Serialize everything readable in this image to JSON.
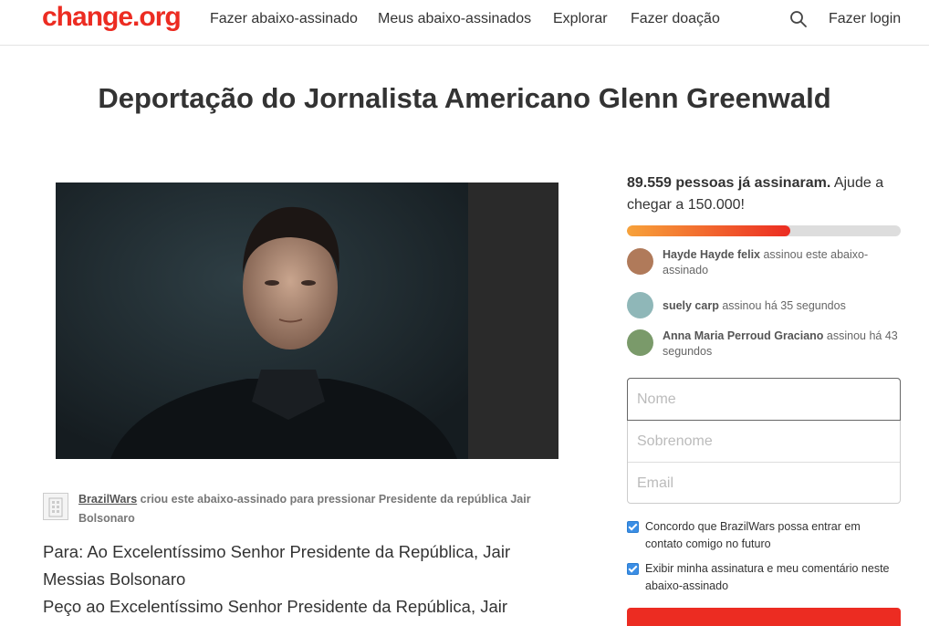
{
  "header": {
    "logo": "change.org",
    "nav": [
      "Fazer abaixo-assinado",
      "Meus abaixo-assinados",
      "Explorar",
      "Fazer doação"
    ],
    "login": "Fazer login"
  },
  "petition": {
    "title": "Deportação do Jornalista Americano Glenn Greenwald",
    "creator": {
      "author": "BrazilWars",
      "text": " criou este abaixo-assinado para pressionar Presidente da república Jair Bolsonaro"
    },
    "body": [
      "Para: Ao Excelentíssimo Senhor Presidente da República, Jair Messias Bolsonaro",
      "Peço ao Excelentíssimo Senhor Presidente da República, Jair"
    ]
  },
  "signatures": {
    "count_text": "89.559 pessoas já assinaram.",
    "goal_text": " Ajude a chegar a 150.000!",
    "progress": 0.597,
    "recent": [
      {
        "name": "Hayde Hayde felix",
        "action": " assinou este abaixo-assinado",
        "avatar_color": "#b07a5a"
      },
      {
        "name": "suely carp",
        "action": " assinou há 35 segundos",
        "avatar_color": "#8fb7b8"
      },
      {
        "name": "Anna Maria Perroud Graciano",
        "action": " assinou há 43 segundos",
        "avatar_color": "#7a9a6a"
      }
    ]
  },
  "form": {
    "first_name_placeholder": "Nome",
    "last_name_placeholder": "Sobrenome",
    "email_placeholder": "Email",
    "checkbox_contact": "Concordo que BrazilWars possa entrar em contato comigo no futuro",
    "checkbox_display": "Exibir minha assinatura e meu comentário neste abaixo-assinado"
  },
  "colors": {
    "brand": "#ec2c22",
    "progress_start": "#f7a23a",
    "checkbox": "#3b8ee5"
  }
}
